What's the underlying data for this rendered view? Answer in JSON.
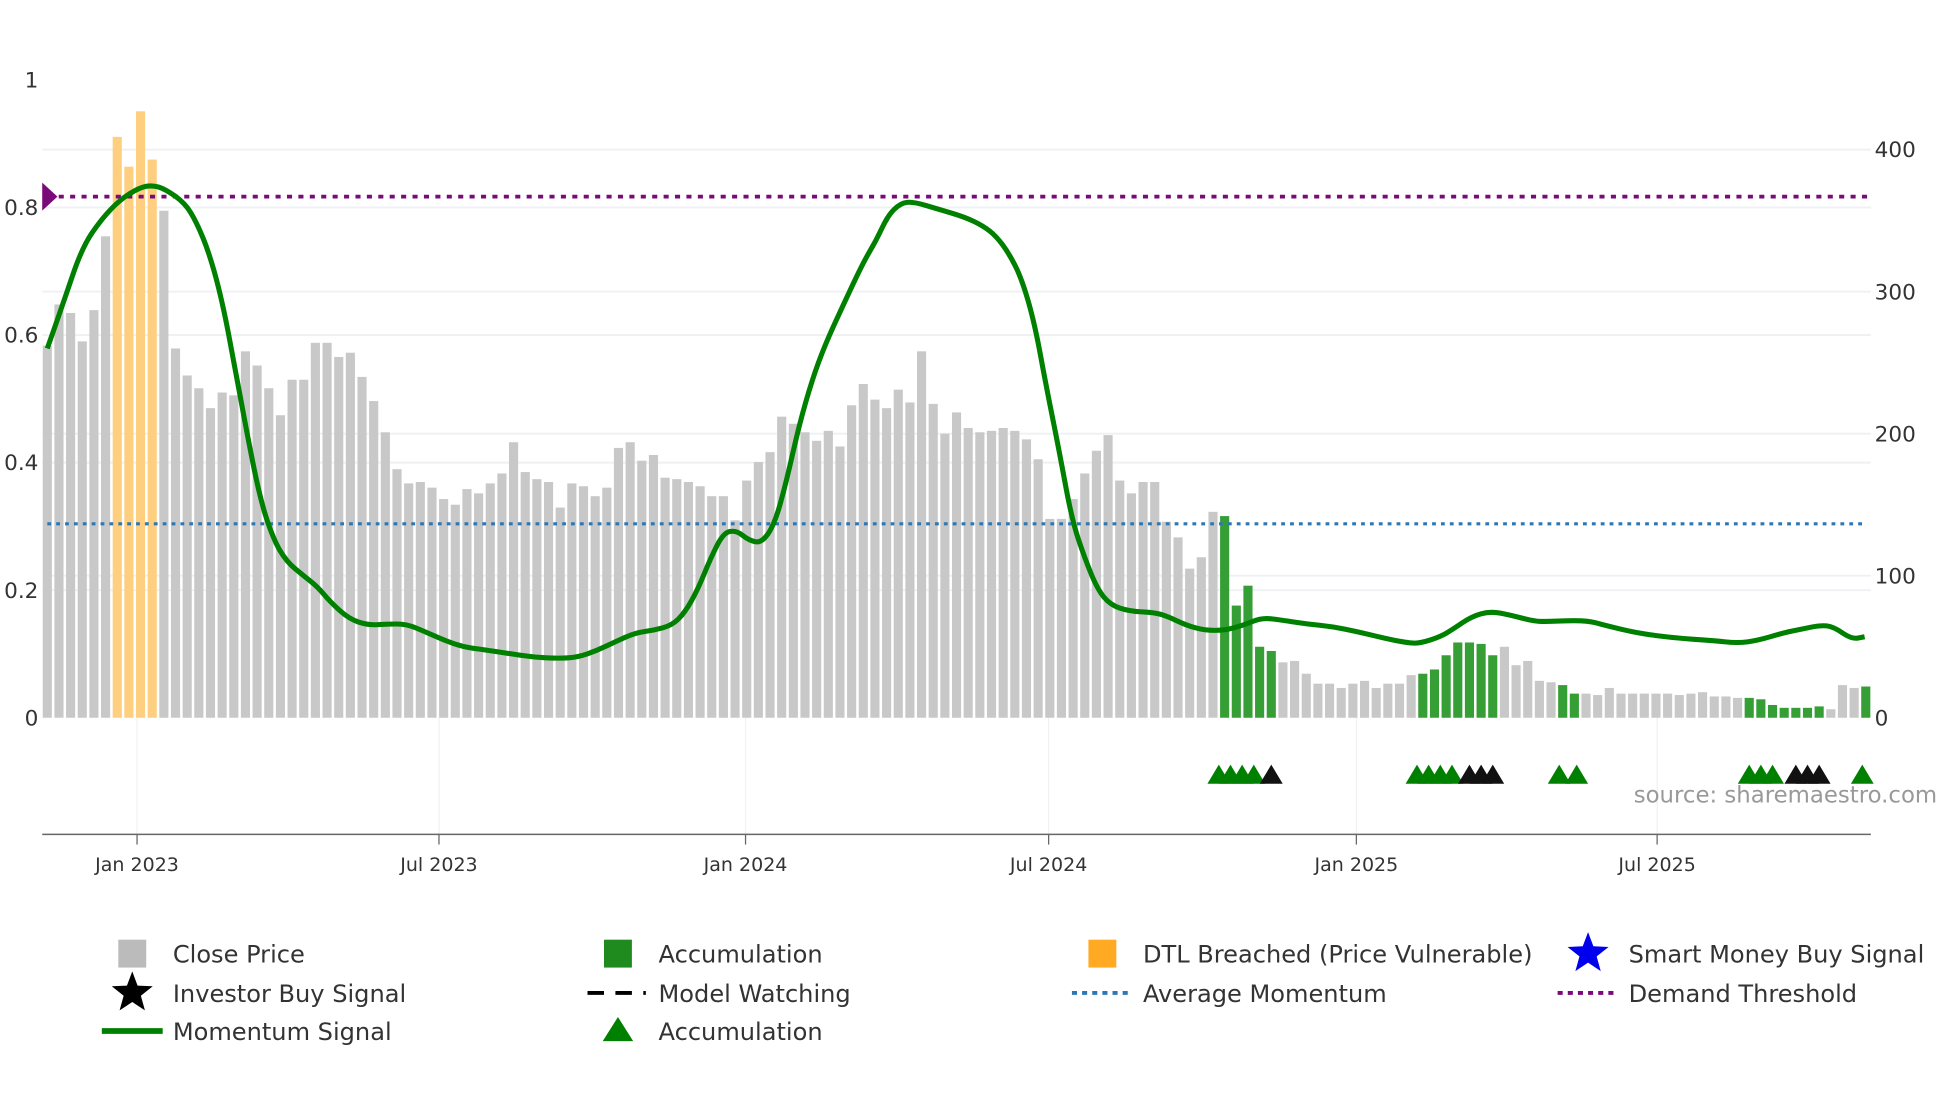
{
  "chart_data": {
    "type": "bar",
    "title": "",
    "left_axis": {
      "ticks": [
        "0",
        "0.2",
        "0.4",
        "0.6",
        "0.8",
        "1"
      ],
      "range": [
        0,
        1
      ]
    },
    "right_axis": {
      "ticks": [
        "0",
        "100",
        "200",
        "300",
        "400"
      ],
      "range": [
        0,
        450
      ]
    },
    "x_ticks": [
      "Jan 2023",
      "Jul 2023",
      "Jan 2024",
      "Jul 2024",
      "Jan 2025",
      "Jul 2025"
    ],
    "x_tick_week_index": [
      7.7,
      33.6,
      59.9,
      85.9,
      112.3,
      138.1
    ],
    "grid": true,
    "close_price": [
      262,
      291,
      285,
      265,
      287,
      339,
      409,
      388,
      427,
      393,
      357,
      260,
      241,
      232,
      218,
      229,
      227,
      258,
      248,
      232,
      213,
      238,
      238,
      264,
      264,
      254,
      257,
      240,
      223,
      201,
      175,
      165,
      166,
      162,
      154,
      150,
      161,
      158,
      165,
      172,
      194,
      173,
      168,
      166,
      148,
      165,
      163,
      156,
      162,
      190,
      194,
      181,
      185,
      169,
      168,
      166,
      163,
      156,
      156,
      139,
      167,
      180,
      187,
      212,
      207,
      201,
      195,
      202,
      191,
      220,
      235,
      224,
      218,
      231,
      222,
      258,
      221,
      200,
      215,
      204,
      201,
      202,
      204,
      202,
      196,
      182,
      140,
      140,
      154,
      172,
      188,
      199,
      167,
      158,
      166,
      166,
      138,
      127,
      105,
      113,
      145,
      142,
      79,
      93,
      50,
      47,
      39,
      40,
      31,
      24,
      24,
      21,
      24,
      26,
      21,
      24,
      24,
      30,
      31,
      34,
      44,
      53,
      53,
      52,
      44,
      50,
      37,
      40,
      26,
      25,
      23,
      17,
      17,
      16,
      21,
      17,
      17,
      17,
      17,
      17,
      16,
      17,
      18,
      15,
      15,
      14,
      14,
      13,
      9,
      7,
      7,
      7,
      8,
      6,
      23,
      21,
      22
    ],
    "dtl_ranges": [
      [
        6,
        9
      ]
    ],
    "accumulation_ranges": [
      [
        101,
        105
      ],
      [
        118,
        124
      ],
      [
        130,
        131
      ],
      [
        146,
        152
      ],
      [
        156,
        156
      ]
    ],
    "momentum": [
      [
        0,
        0.579
      ],
      [
        1.4,
        0.652
      ],
      [
        3.0,
        0.738
      ],
      [
        4.7,
        0.783
      ],
      [
        6.3,
        0.813
      ],
      [
        7.9,
        0.831
      ],
      [
        9.0,
        0.835
      ],
      [
        10.1,
        0.829
      ],
      [
        11.8,
        0.807
      ],
      [
        12.8,
        0.777
      ],
      [
        13.9,
        0.728
      ],
      [
        15.0,
        0.654
      ],
      [
        16.1,
        0.549
      ],
      [
        17.2,
        0.439
      ],
      [
        18.3,
        0.34
      ],
      [
        19.4,
        0.28
      ],
      [
        20.5,
        0.245
      ],
      [
        22.1,
        0.221
      ],
      [
        23.2,
        0.205
      ],
      [
        24.3,
        0.181
      ],
      [
        25.9,
        0.155
      ],
      [
        27.5,
        0.145
      ],
      [
        29.2,
        0.147
      ],
      [
        30.8,
        0.147
      ],
      [
        32.4,
        0.135
      ],
      [
        34.1,
        0.121
      ],
      [
        35.7,
        0.111
      ],
      [
        37.3,
        0.107
      ],
      [
        39.5,
        0.101
      ],
      [
        41.7,
        0.095
      ],
      [
        43.9,
        0.093
      ],
      [
        45.5,
        0.095
      ],
      [
        47.1,
        0.105
      ],
      [
        48.7,
        0.119
      ],
      [
        50.4,
        0.133
      ],
      [
        52.0,
        0.137
      ],
      [
        53.6,
        0.145
      ],
      [
        54.7,
        0.165
      ],
      [
        55.8,
        0.201
      ],
      [
        56.9,
        0.25
      ],
      [
        58.0,
        0.29
      ],
      [
        59.1,
        0.294
      ],
      [
        60.2,
        0.278
      ],
      [
        61.3,
        0.274
      ],
      [
        62.4,
        0.304
      ],
      [
        63.4,
        0.37
      ],
      [
        64.5,
        0.459
      ],
      [
        65.6,
        0.529
      ],
      [
        66.7,
        0.584
      ],
      [
        68.3,
        0.648
      ],
      [
        70.0,
        0.714
      ],
      [
        71.1,
        0.748
      ],
      [
        72.1,
        0.787
      ],
      [
        73.2,
        0.807
      ],
      [
        74.3,
        0.809
      ],
      [
        76.5,
        0.797
      ],
      [
        78.7,
        0.785
      ],
      [
        80.3,
        0.771
      ],
      [
        81.4,
        0.755
      ],
      [
        82.5,
        0.728
      ],
      [
        83.6,
        0.688
      ],
      [
        84.7,
        0.618
      ],
      [
        85.7,
        0.519
      ],
      [
        86.8,
        0.419
      ],
      [
        87.9,
        0.31
      ],
      [
        89.0,
        0.25
      ],
      [
        90.1,
        0.201
      ],
      [
        91.2,
        0.177
      ],
      [
        92.8,
        0.167
      ],
      [
        95.0,
        0.165
      ],
      [
        96.1,
        0.159
      ],
      [
        97.7,
        0.145
      ],
      [
        99.3,
        0.137
      ],
      [
        101.0,
        0.137
      ],
      [
        102.6,
        0.145
      ],
      [
        104.2,
        0.157
      ],
      [
        105.9,
        0.153
      ],
      [
        108.1,
        0.147
      ],
      [
        110.2,
        0.143
      ],
      [
        112.4,
        0.135
      ],
      [
        114.6,
        0.125
      ],
      [
        116.8,
        0.117
      ],
      [
        117.8,
        0.117
      ],
      [
        119.5,
        0.127
      ],
      [
        120.6,
        0.139
      ],
      [
        122.2,
        0.159
      ],
      [
        123.8,
        0.167
      ],
      [
        125.5,
        0.161
      ],
      [
        127.6,
        0.151
      ],
      [
        128.7,
        0.151
      ],
      [
        132.0,
        0.153
      ],
      [
        133.6,
        0.145
      ],
      [
        136.3,
        0.133
      ],
      [
        139.6,
        0.125
      ],
      [
        142.9,
        0.121
      ],
      [
        145.0,
        0.117
      ],
      [
        146.7,
        0.121
      ],
      [
        148.9,
        0.133
      ],
      [
        150.5,
        0.139
      ],
      [
        152.1,
        0.145
      ],
      [
        153.2,
        0.143
      ],
      [
        154.8,
        0.123
      ],
      [
        155.9,
        0.127
      ]
    ],
    "demand_threshold": 0.817,
    "average_momentum": 0.304,
    "accumulation_markers": [
      100.5,
      101.5,
      102.5,
      103.5,
      117.5,
      118.5,
      119.5,
      120.5,
      129.7,
      131.2,
      146,
      147,
      148,
      155.7
    ],
    "model_watching_markers": [
      105,
      122,
      123,
      124,
      150,
      151,
      152
    ],
    "legend": [
      {
        "label": "Close Price",
        "symbol": "square",
        "color": "#bbbbbb"
      },
      {
        "label": "Accumulation",
        "symbol": "square",
        "color": "#1f8b1f"
      },
      {
        "label": "DTL Breached (Price Vulnerable)",
        "symbol": "square",
        "color": "#ffaa22"
      },
      {
        "label": "Smart Money Buy Signal",
        "symbol": "star",
        "color": "#0000ee"
      },
      {
        "label": "Investor Buy Signal",
        "symbol": "star",
        "color": "#000000"
      },
      {
        "label": "Model Watching",
        "symbol": "dash",
        "color": "#000000"
      },
      {
        "label": "Average Momentum",
        "symbol": "dot",
        "color": "#2f77b4"
      },
      {
        "label": "Demand Threshold",
        "symbol": "dot",
        "color": "#7a0a7a"
      },
      {
        "label": "Momentum Signal",
        "symbol": "line",
        "color": "#008000"
      },
      {
        "label": "Accumulation",
        "symbol": "triangle",
        "color": "#008000"
      }
    ],
    "source": "source: sharemaestro.com"
  }
}
